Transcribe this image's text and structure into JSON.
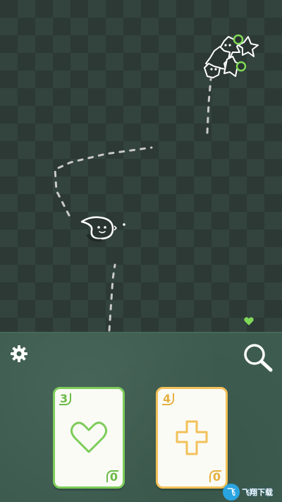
{
  "board": {
    "lives": [
      {
        "state": "empty",
        "color": "#8a7ea8"
      },
      {
        "state": "full",
        "color": "#7fd957"
      },
      {
        "state": "full",
        "color": "#7fd957"
      }
    ]
  },
  "controls": {
    "settings_icon": "gear-icon",
    "search_icon": "magnifier-icon"
  },
  "hand": {
    "cards": [
      {
        "name": "heart-card",
        "cost": "3",
        "power": "0",
        "suit": "heart",
        "color": "#7dcc5a"
      },
      {
        "name": "cross-card",
        "cost": "4",
        "power": "0",
        "suit": "plus",
        "color": "#f2c15a"
      }
    ]
  },
  "watermark": {
    "logo_text": "飞",
    "text": "飞翔下载"
  }
}
